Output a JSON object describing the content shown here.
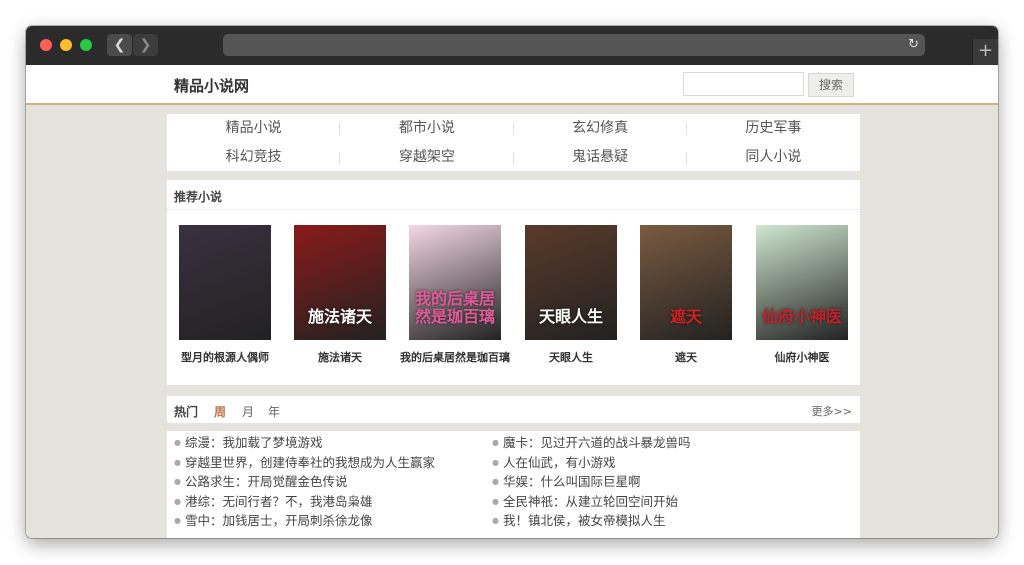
{
  "site": {
    "name": "精品小说网"
  },
  "search": {
    "placeholder": "",
    "value": "",
    "button": "搜索"
  },
  "categories": [
    "精品小说",
    "都市小说",
    "玄幻修真",
    "历史军事",
    "科幻竞技",
    "穿越架空",
    "鬼话悬疑",
    "同人小说"
  ],
  "recommend": {
    "title": "推荐小说",
    "books": [
      {
        "name": "型月的根源人偶师",
        "cover_text": "",
        "bg": "#3a3040",
        "fg": "#ffffff"
      },
      {
        "name": "施法诸天",
        "cover_text": "施法诸天",
        "bg": "#8a1a1a",
        "fg": "#ffffff"
      },
      {
        "name": "我的后桌居然是珈百璃",
        "cover_text": "我的后桌居然是珈百璃",
        "bg": "#f4d8e4",
        "fg": "#e05a9a"
      },
      {
        "name": "天眼人生",
        "cover_text": "天眼人生",
        "bg": "#5a3a2a",
        "fg": "#ffffff"
      },
      {
        "name": "遮天",
        "cover_text": "遮天",
        "bg": "#7a5a40",
        "fg": "#cc2222"
      },
      {
        "name": "仙府小神医",
        "cover_text": "仙府小神医",
        "bg": "#cfe8d0",
        "fg": "#c0202a"
      }
    ]
  },
  "hot": {
    "title": "热门",
    "tabs": [
      "周",
      "月",
      "年"
    ],
    "active": 0,
    "more": "更多>>"
  },
  "hot_list": {
    "left": [
      "综漫：我加载了梦境游戏",
      "穿越里世界，创建侍奉社的我想成为人生赢家",
      "公路求生：开局觉醒金色传说",
      "港综：无间行者？不，我港岛枭雄",
      "雪中：加钱居士，开局刺杀徐龙像"
    ],
    "right": [
      "魔卡：见过开六道的战斗暴龙兽吗",
      "人在仙武，有小游戏",
      "华娱：什么叫国际巨星啊",
      "全民神祇：从建立轮回空间开始",
      "我！镇北侯，被女帝模拟人生"
    ]
  },
  "colors": {
    "accent": "#c2754b",
    "header_border": "#d7b07a",
    "page_bg": "#e4e3de"
  }
}
